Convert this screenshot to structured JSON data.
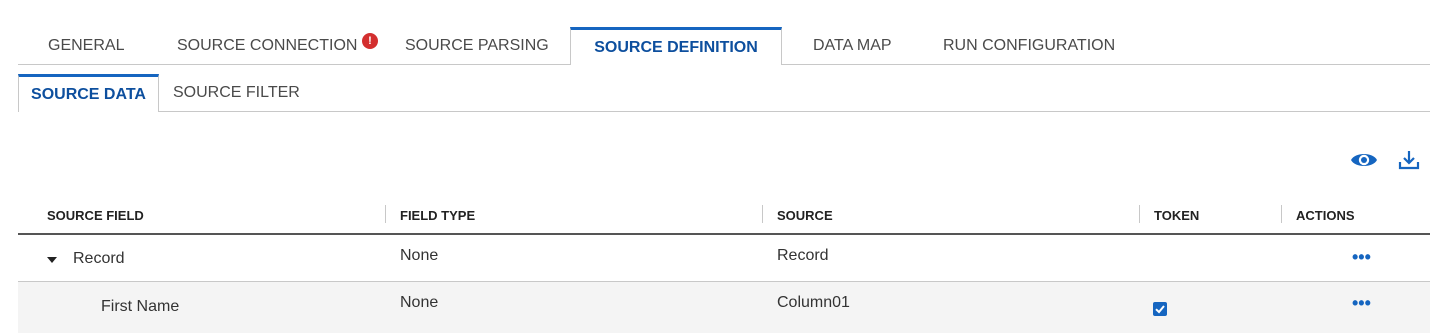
{
  "tabs": [
    {
      "label": "GENERAL"
    },
    {
      "label": "SOURCE CONNECTION",
      "alert": "!"
    },
    {
      "label": "SOURCE PARSING"
    },
    {
      "label": "SOURCE DEFINITION",
      "active": true
    },
    {
      "label": "DATA MAP"
    },
    {
      "label": "RUN CONFIGURATION"
    }
  ],
  "subtabs": [
    {
      "label": "SOURCE DATA",
      "active": true
    },
    {
      "label": "SOURCE FILTER"
    }
  ],
  "toolbar": {
    "icons": [
      "eye-icon",
      "download-icon"
    ]
  },
  "table": {
    "columns": [
      "SOURCE FIELD",
      "FIELD TYPE",
      "SOURCE",
      "TOKEN",
      "ACTIONS"
    ],
    "rows": [
      {
        "field": "Record",
        "type": "None",
        "source": "Record",
        "token": false,
        "expanded": true,
        "actions": "•••"
      },
      {
        "field": "First Name",
        "type": "None",
        "source": "Column01",
        "token": true,
        "actions": "•••"
      }
    ]
  },
  "colors": {
    "accent": "#1565c0",
    "active_tab_text": "#0d4f9e",
    "alert": "#d32f2f"
  }
}
